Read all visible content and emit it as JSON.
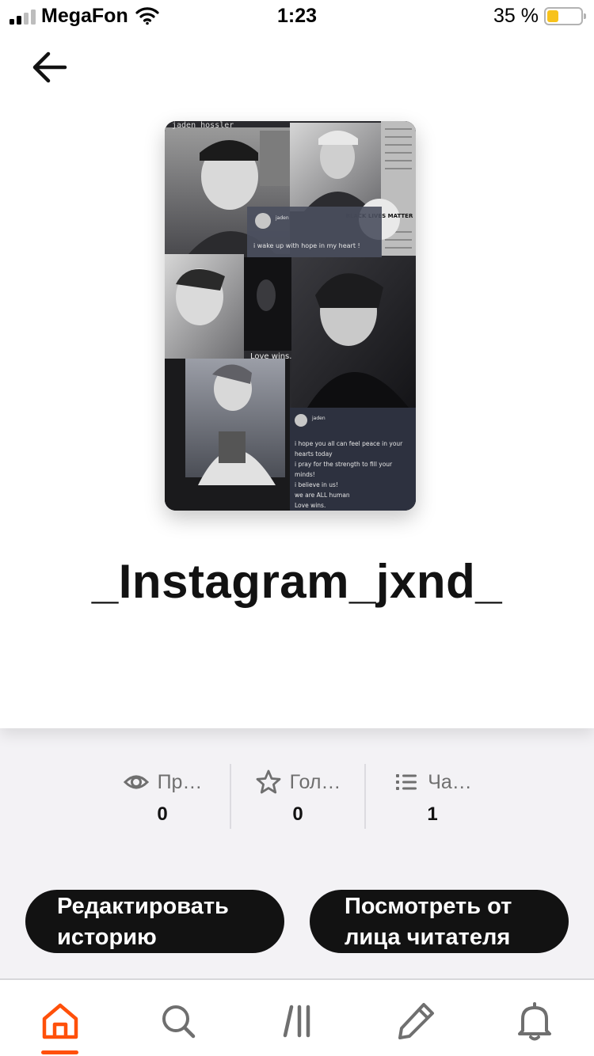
{
  "status_bar": {
    "carrier": "MegaFon",
    "time": "1:23",
    "battery_percent": "35 %",
    "battery_level": 0.35,
    "signal_bars_active": 2,
    "battery_color": "#f7c21b"
  },
  "header": {
    "back_icon": "arrow-left-icon"
  },
  "cover": {
    "caption_top": "jaden hossler",
    "sign_text": "BLACK LIVES MATTER",
    "tweet_1": "i wake up with hope in my heart !",
    "tweet_1_author": "jaden",
    "love_wins": "Love wins.",
    "tweet_2_author": "jaden",
    "tweet_2_lines": [
      "i hope you all can feel peace in your",
      "hearts today",
      "i pray for the strength to fill your",
      "minds!",
      "i believe in us!",
      "we are ALL human",
      "Love wins."
    ]
  },
  "story": {
    "title": "_Instagram_jxnd_"
  },
  "stats": [
    {
      "label": "Пр…",
      "value": "0",
      "icon": "eye-icon"
    },
    {
      "label": "Гол…",
      "value": "0",
      "icon": "star-icon"
    },
    {
      "label": "Ча…",
      "value": "1",
      "icon": "list-icon"
    }
  ],
  "actions": {
    "edit_line1": "Редактировать",
    "edit_line2": "историю",
    "preview_line1": "Посмотреть от",
    "preview_line2": "лица читателя"
  },
  "nav": {
    "items": [
      "home-icon",
      "search-icon",
      "library-icon",
      "write-icon",
      "bell-icon"
    ],
    "active": "home",
    "accent_color": "#ff500a"
  }
}
